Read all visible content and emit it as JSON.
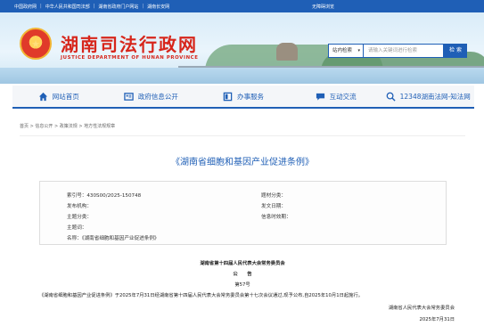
{
  "topbar": {
    "links": [
      "中国政府网",
      "中华人民共和国司法部",
      "湖南省政府门户网站",
      "湖南长安网"
    ],
    "right_link": "无障碍浏览"
  },
  "header": {
    "title": "湖南司法行政网",
    "subtitle": "JUSTICE DEPARTMENT OF HUNAN PROVINCE",
    "emblem_glyph": "★"
  },
  "search": {
    "scope": "站内检索",
    "placeholder": "请输入关键词进行检索",
    "button": "检 索"
  },
  "nav": {
    "items": [
      {
        "label": "网站首页",
        "icon": "home-icon"
      },
      {
        "label": "政府信息公开",
        "icon": "grid-icon"
      },
      {
        "label": "办事服务",
        "icon": "service-icon"
      },
      {
        "label": "互动交流",
        "icon": "chat-icon"
      },
      {
        "label": "12348湖南法网-知法网",
        "icon": "search-globe-icon"
      }
    ]
  },
  "breadcrumb": "首页 > 信息公开 > 政策法规 > 地方性法规规章",
  "document": {
    "title": "《湖南省细胞和基因产业促进条例》",
    "meta": {
      "index_no": "索引号：430S00/2025-150748",
      "topic_class": "题材分类：",
      "issuer": "发布机构：",
      "issue_date": "发文日期：",
      "subject_class": "主题分类：",
      "validity": "信息时效期：",
      "keywords": "主题词：",
      "name": "名称：《湖南省细胞和基因产业促进条例》"
    },
    "heading": "湖南省第十四届人民代表大会常务委员会",
    "notice": "公　　告",
    "number": "第57号",
    "body": "《湖南省细胞和基因产业促进条例》于2025年7月31日经湖南省第十四届人民代表大会常务委员会第十七次会议通过,现予公布,自2025年10月1日起施行。",
    "signature": "湖南省人民代表大会常务委员会",
    "date": "2025年7月31日"
  },
  "colors": {
    "brand_blue": "#1f5fb6",
    "brand_red": "#d7261b"
  }
}
